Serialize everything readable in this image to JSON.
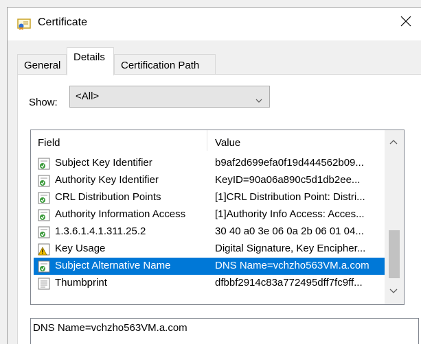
{
  "window": {
    "title": "Certificate",
    "icon": "certificate-icon",
    "close_icon": "close-icon"
  },
  "tabs": [
    {
      "label": "General",
      "selected": false
    },
    {
      "label": "Details",
      "selected": true
    },
    {
      "label": "Certification Path",
      "selected": false
    }
  ],
  "show": {
    "label": "Show:",
    "value": "<All>"
  },
  "list": {
    "columns": {
      "field": "Field",
      "value": "Value"
    },
    "rows": [
      {
        "field": "Subject Key Identifier",
        "value": "b9af2d699efa0f19d444562b09...",
        "icon": "cert-field-icon"
      },
      {
        "field": "Authority Key Identifier",
        "value": "KeyID=90a06a890c5d1db2ee...",
        "icon": "cert-field-icon"
      },
      {
        "field": "CRL Distribution Points",
        "value": "[1]CRL Distribution Point: Distri...",
        "icon": "cert-field-icon"
      },
      {
        "field": "Authority Information Access",
        "value": "[1]Authority Info Access: Acces...",
        "icon": "cert-field-icon"
      },
      {
        "field": "1.3.6.1.4.1.311.25.2",
        "value": "30 40 a0 3e 06 0a 2b 06 01 04...",
        "icon": "cert-field-icon"
      },
      {
        "field": "Key Usage",
        "value": "Digital Signature, Key Encipher...",
        "icon": "warning-icon"
      },
      {
        "field": "Subject Alternative Name",
        "value": "DNS Name=vchzho563VM.a.com",
        "icon": "cert-field-icon",
        "selected": true
      },
      {
        "field": "Thumbprint",
        "value": "dfbbf2914c83a772495dff7fc9ff...",
        "icon": "document-icon"
      }
    ]
  },
  "detail": {
    "text": "DNS Name=vchzho563VM.a.com"
  },
  "colors": {
    "selection": "#0078d7"
  }
}
